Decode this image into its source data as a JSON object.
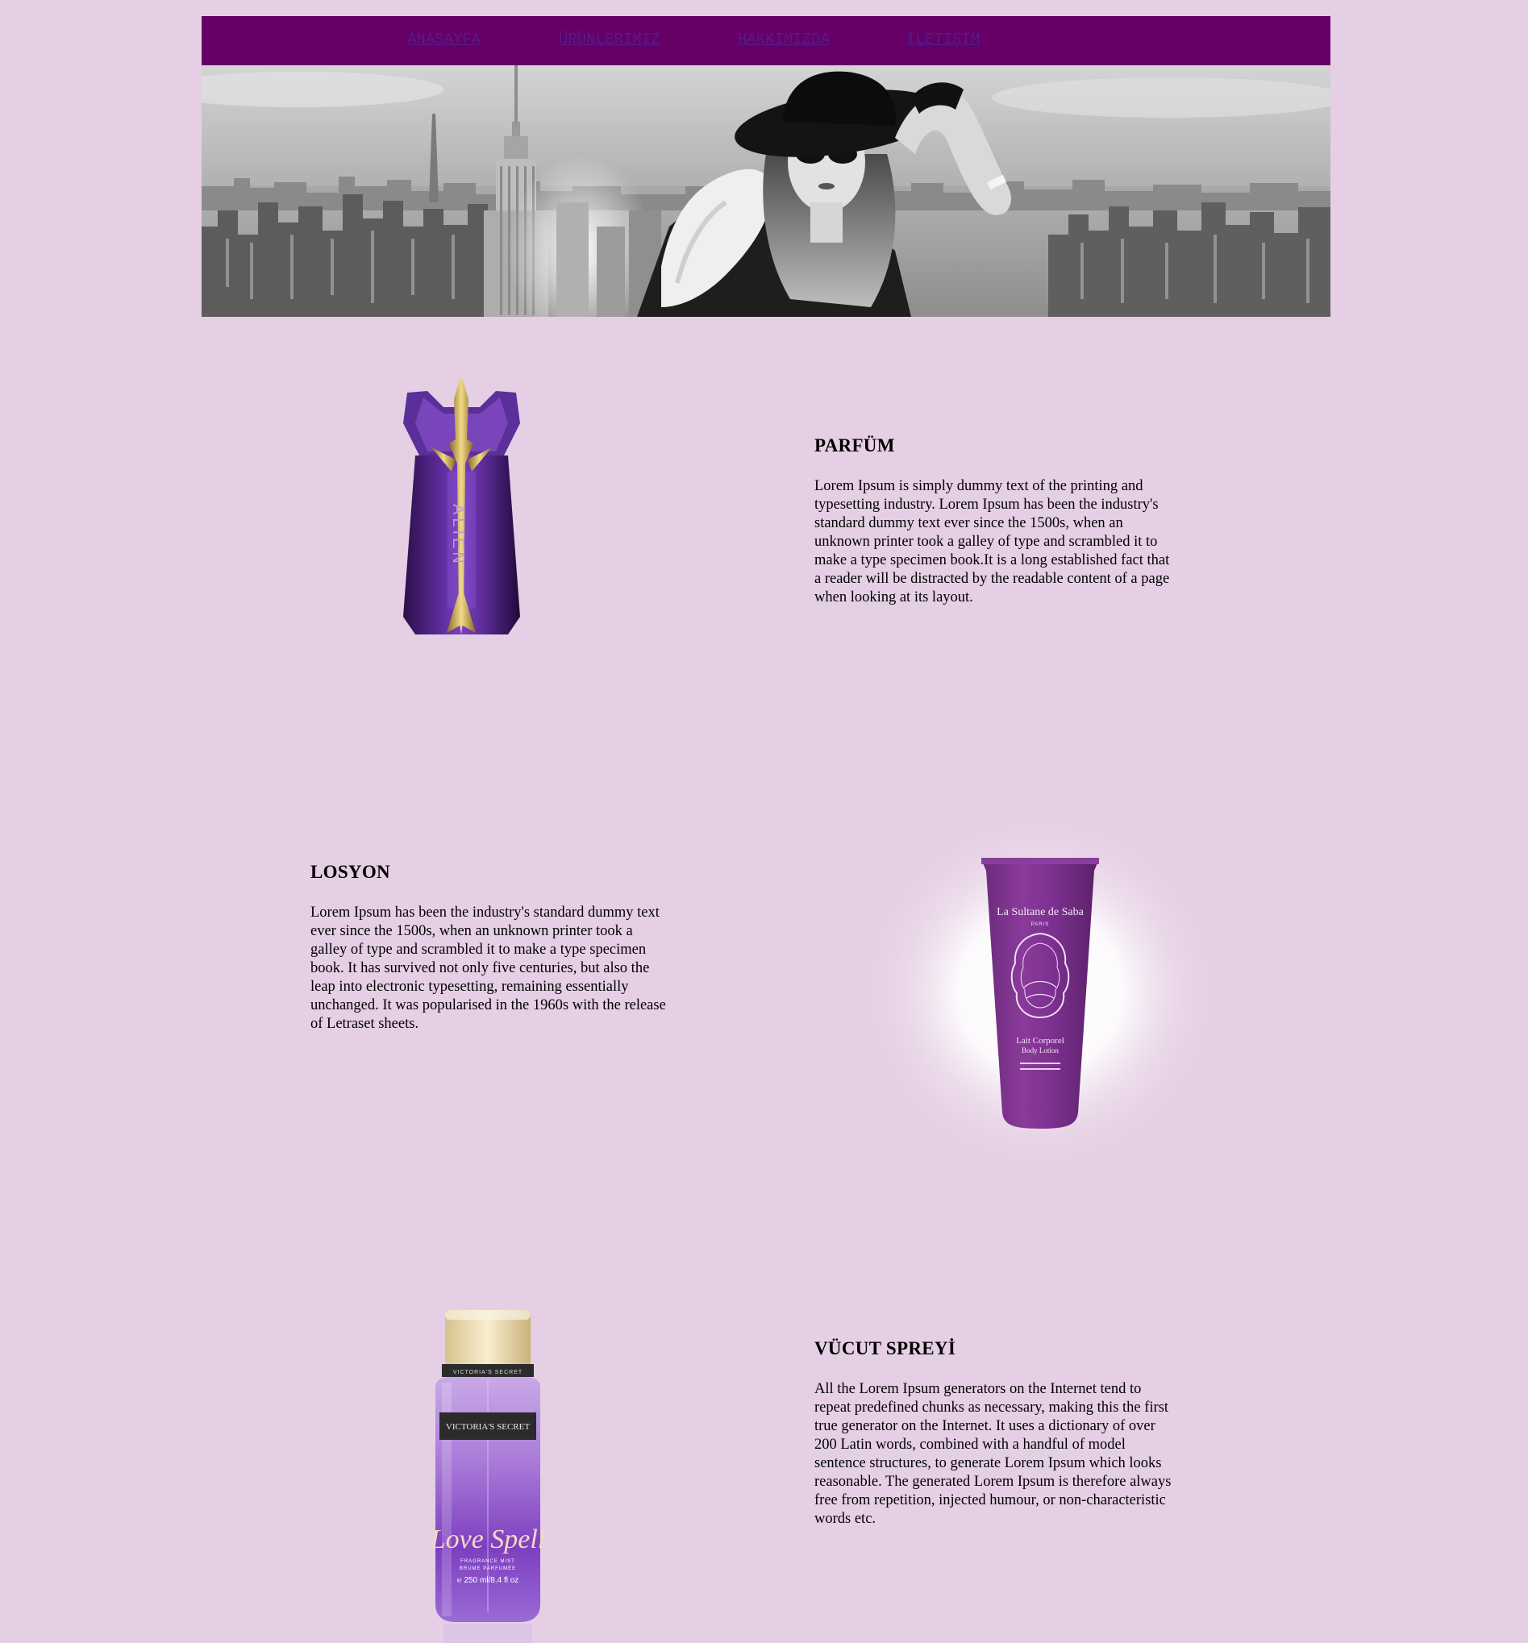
{
  "nav": {
    "items": [
      "ANASAYFA",
      "ÜRÜNLERİMİZ",
      "HAKKIMIZDA",
      "İLETİŞİM"
    ],
    "bg_color": "#660066",
    "link_color": "#551a8b"
  },
  "hero": {
    "description_icon": "city-skyline-with-woman-in-hat-banner"
  },
  "products": [
    {
      "title": "PARFÜM",
      "text": "Lorem Ipsum is simply dummy text of the printing and typesetting industry. Lorem Ipsum has been the industry's standard dummy text ever since the 1500s, when an unknown printer took a galley of type and scrambled it to make a type specimen book.It is a long established fact that a reader will be distracted by the readable content of a page when looking at its layout.",
      "image_icon": "perfume-bottle-icon",
      "bottle_label": "ALIEN"
    },
    {
      "title": "LOSYON",
      "text": "Lorem Ipsum has been the industry's standard dummy text ever since the 1500s, when an unknown printer took a galley of type and scrambled it to make a type specimen book. It has survived not only five centuries, but also the leap into electronic typesetting, remaining essentially unchanged. It was popularised in the 1960s with the release of Letraset sheets.",
      "image_icon": "lotion-tube-icon",
      "tube_brand": "La Sultane de Saba",
      "tube_city": "PARIS",
      "tube_product": "Lait Corporel",
      "tube_product_en": "Body Lotion"
    },
    {
      "title": "VÜCUT SPREYİ",
      "text": "All the Lorem Ipsum generators on the Internet tend to repeat predefined chunks as necessary, making this the first true generator on the Internet. It uses a dictionary of over 200 Latin words, combined with a handful of model sentence structures, to generate Lorem Ipsum which looks reasonable. The generated Lorem Ipsum is therefore always free from repetition, injected humour, or non-characteristic words etc.",
      "image_icon": "body-mist-bottle-icon",
      "bottle_brand": "VICTORIA'S SECRET",
      "bottle_name": "Love Spell",
      "bottle_sub": "FRAGRANCE MIST",
      "bottle_sub2": "BRUME PARFUMÉE",
      "bottle_size": "℮ 250 ml/8.4 fl oz"
    }
  ],
  "colors": {
    "page_bg": "#e5cfe4",
    "accent_purple": "#660066"
  }
}
